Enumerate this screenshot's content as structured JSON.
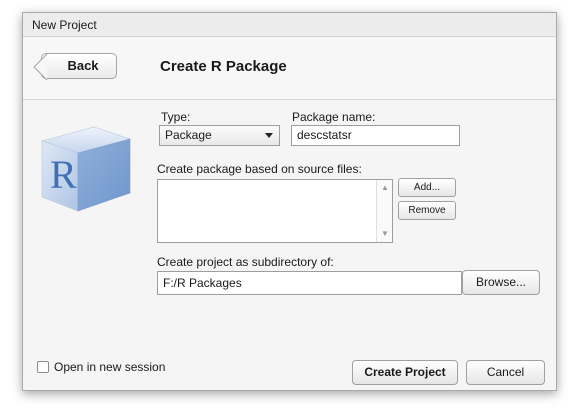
{
  "window": {
    "title": "New Project"
  },
  "header": {
    "back_label": "Back",
    "title": "Create R Package"
  },
  "logo": {
    "letter": "R"
  },
  "form": {
    "type_label": "Type:",
    "type_value": "Package",
    "package_name_label": "Package name:",
    "package_name_value": "descstatsr",
    "source_files_label": "Create package based on source files:",
    "add_label": "Add...",
    "remove_label": "Remove",
    "subdir_label": "Create project as subdirectory of:",
    "subdir_value": "F:/R Packages",
    "browse_label": "Browse..."
  },
  "footer": {
    "open_session_label": "Open in new session",
    "create_label": "Create Project",
    "cancel_label": "Cancel"
  },
  "colors": {
    "logo_blue": "#5b86c4",
    "logo_light": "#b9cde8"
  }
}
